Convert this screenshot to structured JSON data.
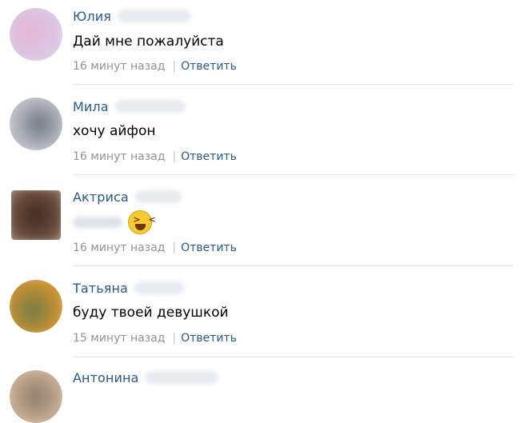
{
  "comments": [
    {
      "name": "Юлия",
      "text": "Дай мне пожалуйста",
      "time": "16 минут назад",
      "separator": "|",
      "reply_label": "Ответить",
      "avatar_colors": [
        "#e6b6d0",
        "#d9c6e3",
        "#f0dbe9"
      ]
    },
    {
      "name": "Мила",
      "text": "хочу айфон",
      "time": "16 минут назад",
      "separator": "|",
      "reply_label": "Ответить",
      "avatar_colors": [
        "#b9bcc4",
        "#6f7580",
        "#d3d6db"
      ]
    },
    {
      "name": "Актриса",
      "text": "",
      "emoji": "laughing-emoji",
      "time": "16 минут назад",
      "separator": "|",
      "reply_label": "Ответить",
      "avatar_colors": [
        "#6a4a3c",
        "#3f2a22",
        "#a98a77"
      ]
    },
    {
      "name": "Татьяна",
      "text": "буду твоей девушкой",
      "time": "15 минут назад",
      "separator": "|",
      "reply_label": "Ответить",
      "avatar_colors": [
        "#c9902f",
        "#6f7d4a",
        "#e2b35a"
      ]
    },
    {
      "name": "Антонина",
      "avatar_colors": [
        "#c4a98f",
        "#8a7c6c",
        "#ddd0c1"
      ]
    }
  ]
}
